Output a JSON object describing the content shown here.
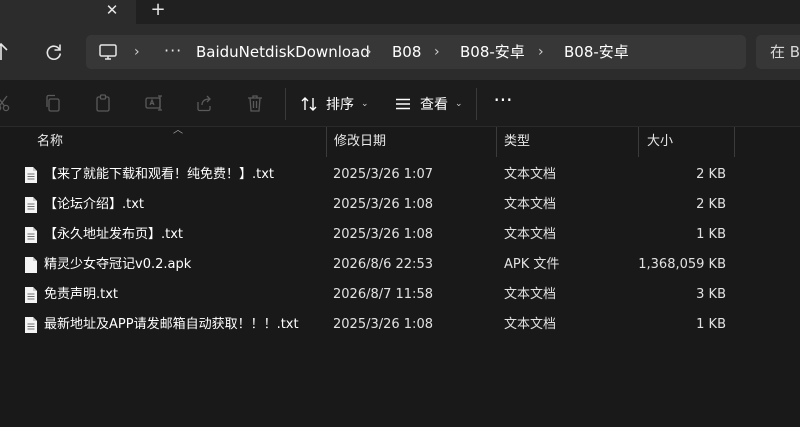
{
  "window": {
    "tab_close_icon": "close-icon",
    "new_tab_icon": "plus-icon"
  },
  "breadcrumb": {
    "more": "···",
    "items": [
      "BaiduNetdiskDownload",
      "B08",
      "B08-安卓",
      "B08-安卓"
    ]
  },
  "search": {
    "placeholder": "在 B"
  },
  "toolbar": {
    "sort_label": "排序",
    "view_label": "查看",
    "more_label": "···"
  },
  "columns": {
    "name": "名称",
    "date": "修改日期",
    "type": "类型",
    "size": "大小"
  },
  "files": [
    {
      "name": "【来了就能下载和观看！纯免费！】.txt",
      "date": "2025/3/26 1:07",
      "type": "文本文档",
      "size": "2 KB",
      "icon": "text-file-icon"
    },
    {
      "name": "【论坛介绍】.txt",
      "date": "2025/3/26 1:08",
      "type": "文本文档",
      "size": "2 KB",
      "icon": "text-file-icon"
    },
    {
      "name": "【永久地址发布页】.txt",
      "date": "2025/3/26 1:08",
      "type": "文本文档",
      "size": "1 KB",
      "icon": "text-file-icon"
    },
    {
      "name": "精灵少女夺冠记v0.2.apk",
      "date": "2026/8/6 22:53",
      "type": "APK 文件",
      "size": "1,368,059 KB",
      "icon": "blank-file-icon"
    },
    {
      "name": "免责声明.txt",
      "date": "2026/8/7 11:58",
      "type": "文本文档",
      "size": "3 KB",
      "icon": "text-file-icon"
    },
    {
      "name": "最新地址及APP请发邮箱自动获取！！！.txt",
      "date": "2025/3/26 1:08",
      "type": "文本文档",
      "size": "1 KB",
      "icon": "text-file-icon"
    }
  ],
  "colors": {
    "background": "#191919",
    "toolbar": "#2c2c2c",
    "address_field": "#373737",
    "text": "#ffffff"
  }
}
